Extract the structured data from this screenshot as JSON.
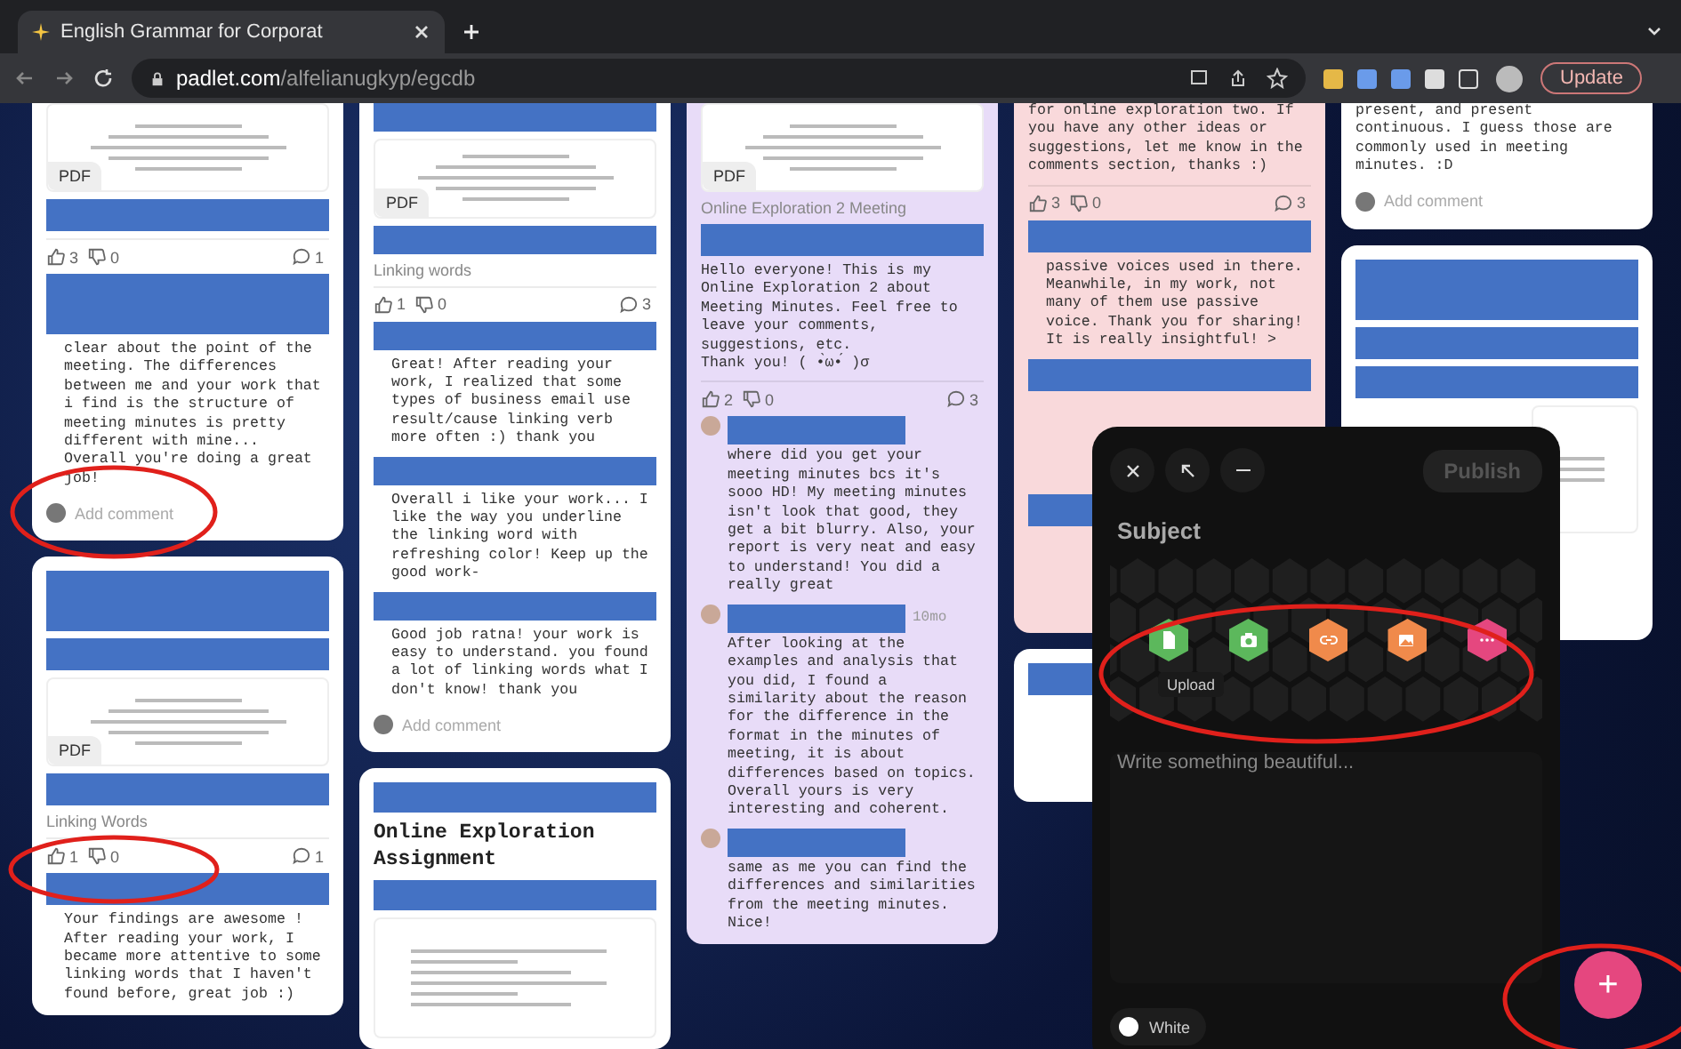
{
  "browser": {
    "tab_title": "English Grammar for Corporat",
    "url_host": "padlet.com",
    "url_path": "/alfelianugkyp/egcdb",
    "update_label": "Update"
  },
  "columns": [
    {
      "cards": [
        {
          "color": "#ffffff",
          "blocks": [
            {
              "kind": "pdf",
              "badge": "PDF"
            },
            {
              "kind": "redacted"
            },
            {
              "kind": "reactions",
              "likes": "3",
              "dislikes": "0",
              "comments": "1"
            },
            {
              "kind": "redacted_tall"
            },
            {
              "kind": "comment",
              "text": "clear about the point of the meeting. The differences between me and your work that i find is the structure of meeting minutes is pretty different with mine... Overall you're doing a great job!"
            },
            {
              "kind": "add_comment",
              "text": "Add comment"
            }
          ]
        },
        {
          "color": "#ffffff",
          "blocks": [
            {
              "kind": "redacted_tall"
            },
            {
              "kind": "redacted"
            },
            {
              "kind": "pdf",
              "badge": "PDF"
            },
            {
              "kind": "redacted"
            },
            {
              "kind": "caption",
              "text": "Linking Words"
            },
            {
              "kind": "reactions",
              "likes": "1",
              "dislikes": "0",
              "comments": "1"
            },
            {
              "kind": "redacted"
            },
            {
              "kind": "comment",
              "text": "Your findings are awesome ! After reading your work, I became more attentive to some linking words that I haven't found before, great job :)"
            }
          ]
        }
      ]
    },
    {
      "cards": [
        {
          "color": "#ffffff",
          "blocks": [
            {
              "kind": "redacted"
            },
            {
              "kind": "pdf",
              "badge": "PDF"
            },
            {
              "kind": "redacted"
            },
            {
              "kind": "caption",
              "text": "Linking words"
            },
            {
              "kind": "reactions",
              "likes": "1",
              "dislikes": "0",
              "comments": "3"
            },
            {
              "kind": "redacted"
            },
            {
              "kind": "comment",
              "text": "Great! After reading your work, I realized that some types of business email use result/cause linking verb more often :) thank you"
            },
            {
              "kind": "redacted"
            },
            {
              "kind": "comment",
              "text": "Overall i like your work... I like the way you underline the linking word with refreshing color! Keep up the good work-"
            },
            {
              "kind": "redacted"
            },
            {
              "kind": "comment",
              "text": "Good job ratna! your work is easy to understand. you found a lot of linking words what I don't know! thank you"
            },
            {
              "kind": "add_comment",
              "text": "Add comment"
            }
          ]
        },
        {
          "color": "#ffffff",
          "blocks": [
            {
              "kind": "redacted"
            },
            {
              "kind": "title",
              "text": "Online Exploration Assignment"
            },
            {
              "kind": "redacted"
            },
            {
              "kind": "doc"
            }
          ]
        }
      ]
    },
    {
      "cards": [
        {
          "color": "#e8dcf8",
          "blocks": [
            {
              "kind": "pdf",
              "badge": "PDF"
            },
            {
              "kind": "caption",
              "text": "Online Exploration 2 Meeting"
            },
            {
              "kind": "redacted"
            },
            {
              "kind": "body",
              "text": "Hello everyone! This is my Online Exploration 2 about Meeting Minutes. Feel free to leave your comments, suggestions, etc.\nThank you! ( •̀ω•́ )σ"
            },
            {
              "kind": "reactions",
              "likes": "2",
              "dislikes": "0",
              "comments": "3"
            },
            {
              "kind": "avatar_comment",
              "text": "where did you get your meeting minutes bcs it's sooo HD! My meeting minutes isn't look that good, they get a bit blurry. Also, your report is very neat and easy to understand! You did a really great"
            },
            {
              "kind": "avatar_comment",
              "time": "10mo",
              "text": "After looking at the examples and analysis that you did, I found a similarity about the reason for the difference in the format in the minutes of meeting, it is about differences based on topics. Overall yours is very interesting and coherent."
            },
            {
              "kind": "avatar_comment",
              "text": "same as me you can find the differences and similarities from the meeting minutes. Nice!"
            }
          ]
        }
      ]
    },
    {
      "cards": [
        {
          "color": "#f9d9db",
          "blocks": [
            {
              "kind": "body",
              "text": "for online exploration two. If you have any other ideas or suggestions, let me know in the comments section, thanks :)"
            },
            {
              "kind": "reactions",
              "likes": "3",
              "dislikes": "0",
              "comments": "3"
            },
            {
              "kind": "redacted"
            },
            {
              "kind": "comment",
              "text": "passive voices used in there. Meanwhile, in my work, not many of them use passive voice. Thank you for sharing! It is really insightful! >"
            },
            {
              "kind": "redacted"
            },
            {
              "kind": "filler"
            },
            {
              "kind": "redacted"
            },
            {
              "kind": "filler"
            }
          ]
        },
        {
          "color": "#ffffff",
          "blocks": [
            {
              "kind": "redacted"
            },
            {
              "kind": "filler"
            }
          ]
        }
      ]
    },
    {
      "cards": [
        {
          "color": "#ffffff",
          "blocks": [
            {
              "kind": "body",
              "text": "present, and present continuous. I guess those are commonly used in meeting minutes. :D"
            },
            {
              "kind": "add_comment",
              "text": "Add comment"
            }
          ]
        },
        {
          "color": "#ffffff",
          "blocks": [
            {
              "kind": "redacted_tall"
            },
            {
              "kind": "redacted"
            },
            {
              "kind": "redacted"
            },
            {
              "kind": "doc_right"
            },
            {
              "kind": "filler"
            }
          ]
        }
      ]
    }
  ],
  "composer": {
    "publish_label": "Publish",
    "subject_placeholder": "Subject",
    "attachments": [
      {
        "kind": "upload",
        "color": "#5cb85c"
      },
      {
        "kind": "camera",
        "color": "#5cb85c"
      },
      {
        "kind": "link",
        "color": "#f08a4b"
      },
      {
        "kind": "image",
        "color": "#f08a4b"
      },
      {
        "kind": "more",
        "color": "#e5477f"
      }
    ],
    "tooltip": "Upload",
    "body_placeholder": "Write something beautiful...",
    "color_label": "White"
  },
  "fab_label": "+"
}
